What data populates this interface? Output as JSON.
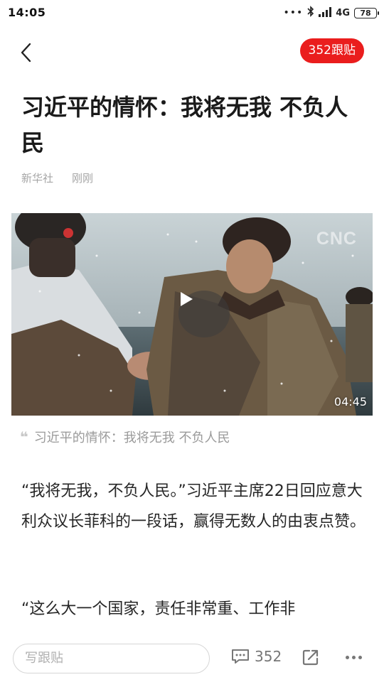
{
  "status_bar": {
    "time": "14:05",
    "network": "4G",
    "battery": "78"
  },
  "nav": {
    "follow_count_label": "352跟贴"
  },
  "article": {
    "title": "习近平的情怀：我将无我 不负人民",
    "source": "新华社",
    "time": "刚刚",
    "video": {
      "duration": "04:45",
      "watermark": "CNC",
      "caption": "习近平的情怀：我将无我 不负人民"
    },
    "paragraphs": [
      "“我将无我，不负人民。”习近平主席22日回应意大利众议长菲科的一段话，赢得无数人的由衷点赞。",
      "“这么大一个国家，责任非常重、工作非"
    ]
  },
  "bottom_bar": {
    "comment_placeholder": "写跟贴",
    "comment_count": "352"
  },
  "colors": {
    "accent": "#ea1d1d",
    "meta_text": "#a6a6a6"
  },
  "icons": [
    "back-arrow-icon",
    "wifi-icon",
    "signal-icon",
    "bluetooth-icon",
    "play-icon",
    "comment-icon",
    "share-icon",
    "more-icon"
  ]
}
